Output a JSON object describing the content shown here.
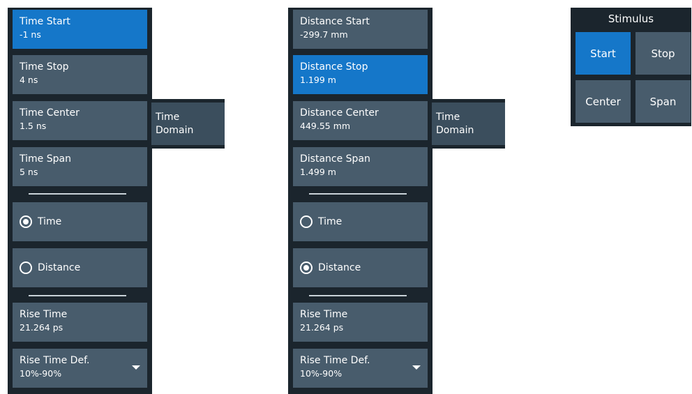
{
  "panel_time": {
    "start": {
      "label": "Time Start",
      "value": "-1 ns"
    },
    "stop": {
      "label": "Time Stop",
      "value": "4 ns"
    },
    "center": {
      "label": "Time Center",
      "value": "1.5 ns"
    },
    "span": {
      "label": "Time Span",
      "value": "5 ns"
    },
    "radio_time": {
      "label": "Time",
      "selected": true
    },
    "radio_distance": {
      "label": "Distance",
      "selected": false
    },
    "rise_time": {
      "label": "Rise Time",
      "value": "21.264 ps"
    },
    "rise_time_def": {
      "label": "Rise Time Def.",
      "value": "10%-90%"
    },
    "flyout": {
      "line1": "Time",
      "line2": "Domain"
    }
  },
  "panel_distance": {
    "start": {
      "label": "Distance Start",
      "value": "-299.7 mm"
    },
    "stop": {
      "label": "Distance Stop",
      "value": "1.199 m"
    },
    "center": {
      "label": "Distance Center",
      "value": "449.55 mm"
    },
    "span": {
      "label": "Distance Span",
      "value": "1.499 m"
    },
    "radio_time": {
      "label": "Time",
      "selected": false
    },
    "radio_distance": {
      "label": "Distance",
      "selected": true
    },
    "rise_time": {
      "label": "Rise Time",
      "value": "21.264 ps"
    },
    "rise_time_def": {
      "label": "Rise Time Def.",
      "value": "10%-90%"
    },
    "flyout": {
      "line1": "Time",
      "line2": "Domain"
    }
  },
  "stimulus": {
    "title": "Stimulus",
    "start": "Start",
    "stop": "Stop",
    "center": "Center",
    "span": "Span"
  },
  "colors": {
    "panel": "#1b252d",
    "button": "#485c6c",
    "active": "#1577c9"
  }
}
